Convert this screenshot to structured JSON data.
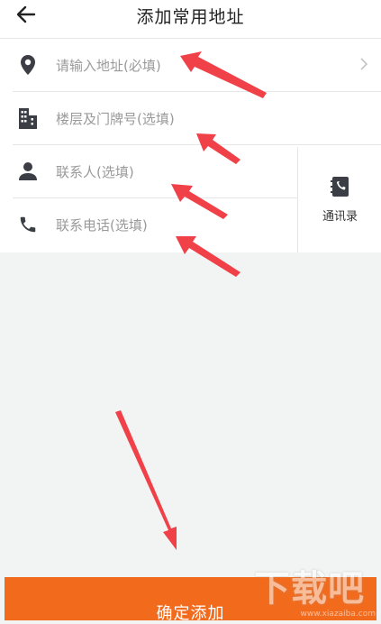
{
  "header": {
    "back_icon": "arrow-left-icon",
    "title": "添加常用地址"
  },
  "form": {
    "address": {
      "icon": "location-pin-icon",
      "placeholder": "请输入地址(必填)",
      "trailing_icon": "chevron-right-icon"
    },
    "floor": {
      "icon": "building-icon",
      "placeholder": "楼层及门牌号(选填)"
    },
    "contact_name": {
      "icon": "person-icon",
      "placeholder": "联系人(选填)"
    },
    "contact_phone": {
      "icon": "phone-icon",
      "placeholder": "联系电话(选填)"
    },
    "contacts_button": {
      "icon": "address-book-icon",
      "label": "通讯录"
    }
  },
  "footer": {
    "confirm_label": "确定添加"
  },
  "watermark": {
    "text": "下载吧",
    "url": "www.xiazaiba.com"
  },
  "colors": {
    "accent": "#f26b1d",
    "annotation_arrow": "#f04048",
    "background": "#f2f3f3",
    "placeholder": "#9a9a9a"
  }
}
